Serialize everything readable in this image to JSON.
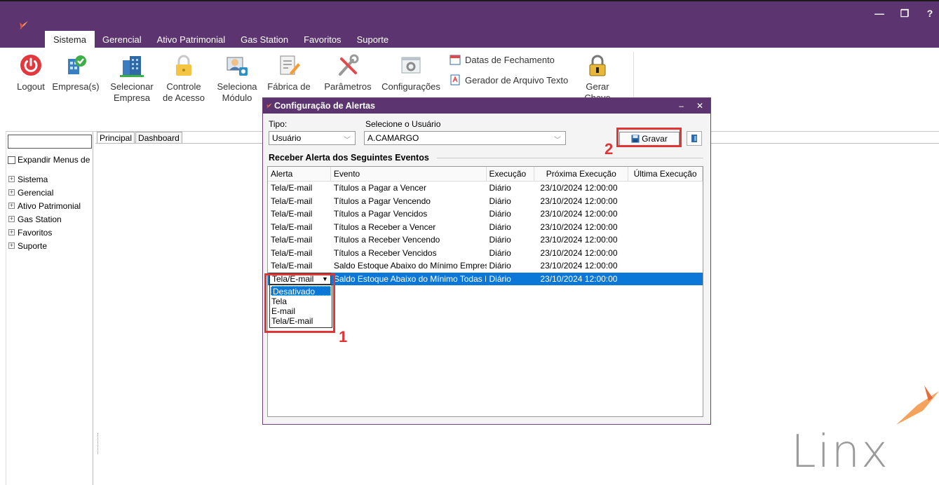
{
  "window": {
    "controls": [
      "—",
      "❐",
      "?"
    ]
  },
  "tabs": [
    {
      "label": "Sistema",
      "active": true
    },
    {
      "label": "Gerencial"
    },
    {
      "label": "Ativo Patrimonial"
    },
    {
      "label": "Gas Station"
    },
    {
      "label": "Favoritos"
    },
    {
      "label": "Suporte"
    }
  ],
  "ribbon": {
    "logout": "Logout",
    "empresas": "Empresa(s)",
    "selecionar_empresa_1": "Selecionar",
    "selecionar_empresa_2": "Empresa",
    "controle_acesso_1": "Controle",
    "controle_acesso_2": "de Acesso",
    "seleciona_modulo_1": "Seleciona",
    "seleciona_modulo_2": "Módulo",
    "fabrica": "Fábrica de",
    "parametros": "Parâmetros",
    "configuracoes": "Configurações",
    "datas_fechamento": "Datas de Fechamento",
    "gerador_arquivo": "Gerador de Arquivo Texto",
    "gerar_chave": "Gerar Chave"
  },
  "left_panel": {
    "expand_label": "Expandir Menus de",
    "tree": [
      "Sistema",
      "Gerencial",
      "Ativo Patrimonial",
      "Gas Station",
      "Favoritos",
      "Suporte"
    ]
  },
  "main_tabs": [
    "Principal",
    "Dashboard"
  ],
  "dialog": {
    "title": "Configuração de Alertas",
    "tipo_label": "Tipo:",
    "tipo_value": "Usuário",
    "usuario_label": "Selecione o Usuário",
    "usuario_value": "A.CAMARGO",
    "gravar": "Gravar",
    "section_title": "Receber Alerta dos Seguintes Eventos",
    "columns": [
      "Alerta",
      "Evento",
      "Execução",
      "Próxima Execução",
      "Última Execução"
    ],
    "rows": [
      [
        "Tela/E-mail",
        "Títulos a Pagar a Vencer",
        "Diário",
        "23/10/2024 12:00:00",
        ""
      ],
      [
        "Tela/E-mail",
        "Títulos a Pagar Vencendo",
        "Diário",
        "23/10/2024 12:00:00",
        ""
      ],
      [
        "Tela/E-mail",
        "Títulos a Pagar Vencidos",
        "Diário",
        "23/10/2024 12:00:00",
        ""
      ],
      [
        "Tela/E-mail",
        "Títulos a Receber a Vencer",
        "Diário",
        "23/10/2024 12:00:00",
        ""
      ],
      [
        "Tela/E-mail",
        "Títulos a Receber Vencendo",
        "Diário",
        "23/10/2024 12:00:00",
        ""
      ],
      [
        "Tela/E-mail",
        "Títulos a Receber Vencidos",
        "Diário",
        "23/10/2024 12:00:00",
        ""
      ],
      [
        "Tela/E-mail",
        "Saldo Estoque Abaixo do Mínimo Empres:",
        "Diário",
        "23/10/2024 12:00:00",
        ""
      ],
      [
        "Tela/E-mail",
        "Saldo Estoque Abaixo do Mínimo Todas E",
        "Diário",
        "23/10/2024 12:00:00",
        ""
      ]
    ],
    "dropdown_options": [
      "Desativado",
      "Tela",
      "E-mail",
      "Tela/E-mail"
    ]
  },
  "annotations": [
    "1",
    "2"
  ],
  "brand": {
    "text": "Linx"
  },
  "colors": {
    "accent": "#5b3470",
    "selection": "#0b78d7",
    "annotation": "#e03535"
  }
}
